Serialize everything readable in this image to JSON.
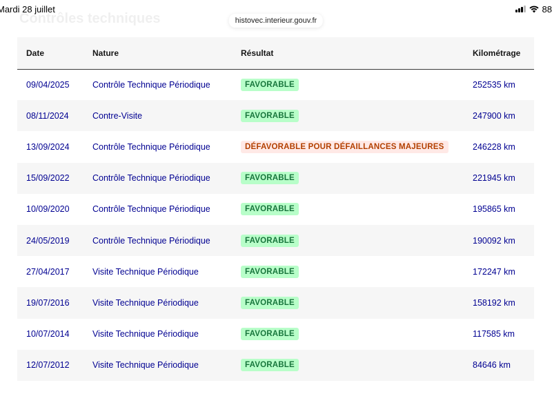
{
  "status_bar": {
    "time_date": "Mardi 28 juillet",
    "battery_text": "88"
  },
  "browser": {
    "url": "histovec.interieur.gouv.fr"
  },
  "section": {
    "heading_faded": "Contrôles techniques"
  },
  "table": {
    "headers": {
      "date": "Date",
      "nature": "Nature",
      "result": "Résultat",
      "km": "Kilométrage"
    },
    "rows": [
      {
        "date": "09/04/2025",
        "nature": "Contrôle Technique Périodique",
        "result": "FAVORABLE",
        "status": "ok",
        "km": "252535 km"
      },
      {
        "date": "08/11/2024",
        "nature": "Contre-Visite",
        "result": "FAVORABLE",
        "status": "ok",
        "km": "247900 km"
      },
      {
        "date": "13/09/2024",
        "nature": "Contrôle Technique Périodique",
        "result": "DÉFAVORABLE POUR DÉFAILLANCES MAJEURES",
        "status": "ko",
        "km": "246228 km"
      },
      {
        "date": "15/09/2022",
        "nature": "Contrôle Technique Périodique",
        "result": "FAVORABLE",
        "status": "ok",
        "km": "221945 km"
      },
      {
        "date": "10/09/2020",
        "nature": "Contrôle Technique Périodique",
        "result": "FAVORABLE",
        "status": "ok",
        "km": "195865 km"
      },
      {
        "date": "24/05/2019",
        "nature": "Contrôle Technique Périodique",
        "result": "FAVORABLE",
        "status": "ok",
        "km": "190092 km"
      },
      {
        "date": "27/04/2017",
        "nature": "Visite Technique Périodique",
        "result": "FAVORABLE",
        "status": "ok",
        "km": "172247 km"
      },
      {
        "date": "19/07/2016",
        "nature": "Visite Technique Périodique",
        "result": "FAVORABLE",
        "status": "ok",
        "km": "158192 km"
      },
      {
        "date": "10/07/2014",
        "nature": "Visite Technique Périodique",
        "result": "FAVORABLE",
        "status": "ok",
        "km": "117585 km"
      },
      {
        "date": "12/07/2012",
        "nature": "Visite Technique Périodique",
        "result": "FAVORABLE",
        "status": "ok",
        "km": "84646 km"
      }
    ]
  },
  "colors": {
    "link_blue": "#000091",
    "favorable_bg": "#b8fec9",
    "favorable_text": "#18753c",
    "defavorable_bg": "#ffe9e6",
    "defavorable_text": "#b34000",
    "stripe": "#f6f6f6"
  },
  "icons": [
    "cellular-signal-icon",
    "wifi-icon"
  ]
}
